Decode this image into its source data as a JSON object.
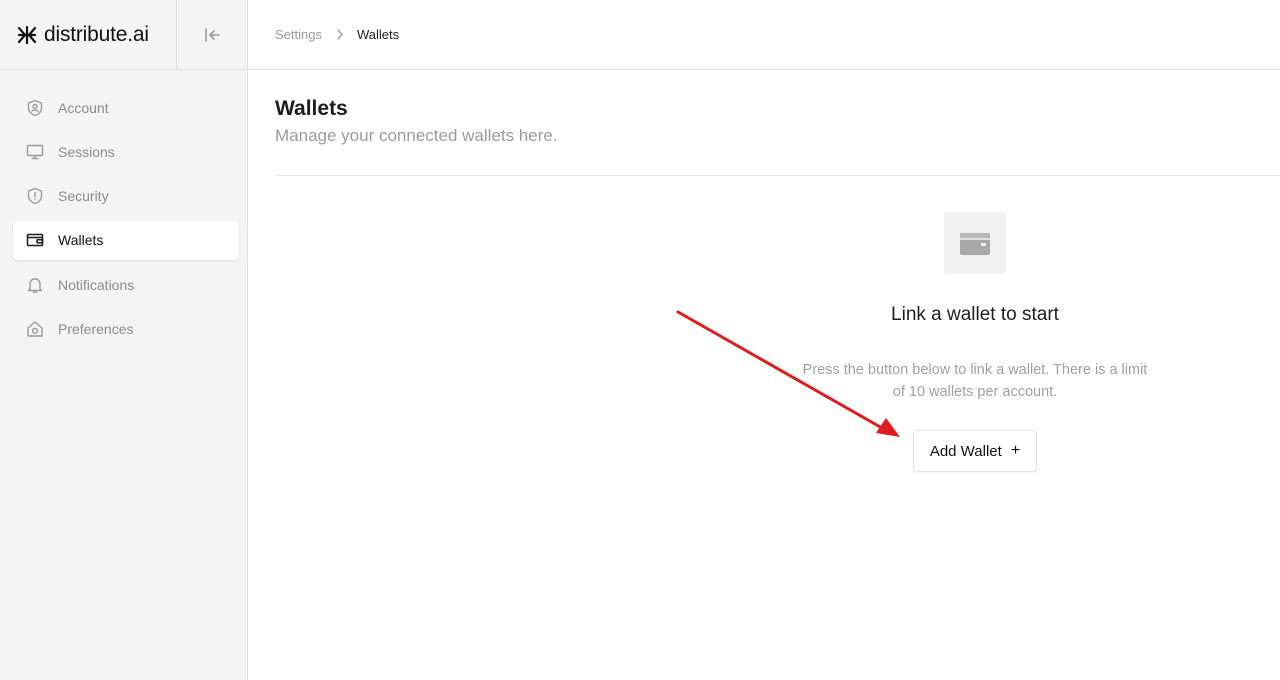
{
  "app": {
    "brand": "distribute.ai"
  },
  "sidebar": {
    "items": [
      {
        "label": "Account",
        "icon": "user-shield-icon",
        "active": false
      },
      {
        "label": "Sessions",
        "icon": "monitor-icon",
        "active": false
      },
      {
        "label": "Security",
        "icon": "shield-alert-icon",
        "active": false
      },
      {
        "label": "Wallets",
        "icon": "wallet-icon",
        "active": true
      },
      {
        "label": "Notifications",
        "icon": "bell-icon",
        "active": false
      },
      {
        "label": "Preferences",
        "icon": "home-gear-icon",
        "active": false
      }
    ]
  },
  "breadcrumb": {
    "parent": "Settings",
    "current": "Wallets"
  },
  "page": {
    "title": "Wallets",
    "subtitle": "Manage your connected wallets here."
  },
  "empty_state": {
    "icon": "wallet-icon",
    "title": "Link a wallet to start",
    "description": "Press the button below to link a wallet. There is a limit of 10 wallets per account.",
    "button_label": "Add Wallet",
    "button_icon": "plus-icon"
  },
  "annotation": {
    "arrow_color": "#e01b1b"
  }
}
